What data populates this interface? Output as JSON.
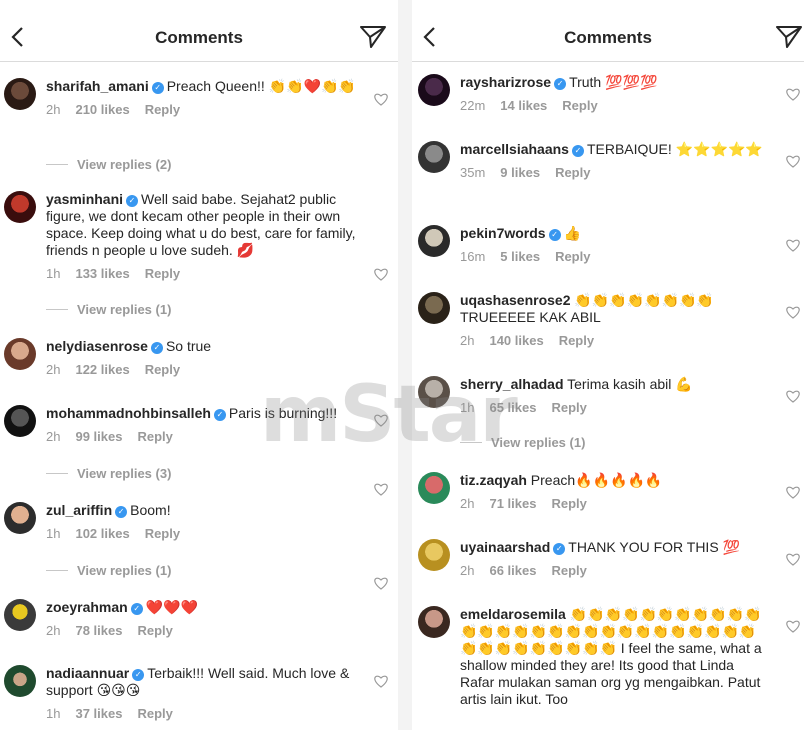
{
  "left": {
    "header": {
      "title": "Comments"
    },
    "comments": [
      {
        "username": "sharifah_amani",
        "text": "Preach Queen!! 👏👏❤️👏👏",
        "time": "2h",
        "likes": "210 likes",
        "reply": "Reply",
        "view_replies": "View replies (2)"
      },
      {
        "username": "yasminhani",
        "text": "Well said babe. Sejahat2 public figure, we dont kecam other people in their own space. Keep doing what u do best, care for family, friends n people u love sudeh. 💋",
        "time": "1h",
        "likes": "133 likes",
        "reply": "Reply",
        "view_replies": "View replies (1)"
      },
      {
        "username": "nelydiasenrose",
        "text": "So true",
        "time": "2h",
        "likes": "122 likes",
        "reply": "Reply"
      },
      {
        "username": "mohammadnohbinsalleh",
        "text": "Paris is burning!!!",
        "time": "2h",
        "likes": "99 likes",
        "reply": "Reply",
        "view_replies": "View replies (3)"
      },
      {
        "username": "zul_ariffin",
        "text": "Boom!",
        "time": "1h",
        "likes": "102 likes",
        "reply": "Reply",
        "view_replies": "View replies (1)"
      },
      {
        "username": "zoeyrahman",
        "text": "❤️❤️❤️",
        "time": "2h",
        "likes": "78 likes",
        "reply": "Reply"
      },
      {
        "username": "nadiaannuar",
        "text": "Terbaik!!! Well said. Much love & support 😘😘😘",
        "time": "1h",
        "likes": "37 likes",
        "reply": "Reply"
      }
    ]
  },
  "right": {
    "header": {
      "title": "Comments"
    },
    "comments": [
      {
        "username": "raysharizrose",
        "text": "Truth 💯💯💯",
        "time": "22m",
        "likes": "14 likes",
        "reply": "Reply"
      },
      {
        "username": "marcellsiahaans",
        "text": "TERBAIQUE! ⭐⭐⭐⭐⭐",
        "time": "35m",
        "likes": "9 likes",
        "reply": "Reply"
      },
      {
        "username": "pekin7words",
        "text": "👍",
        "time": "16m",
        "likes": "5 likes",
        "reply": "Reply"
      },
      {
        "username": "uqashasenrose2",
        "text": "👏👏👏👏👏👏👏👏 TRUEEEEE KAK ABIL",
        "time": "2h",
        "likes": "140 likes",
        "reply": "Reply"
      },
      {
        "username": "sherry_alhadad",
        "text": "Terima kasih abil 💪",
        "time": "1h",
        "likes": "65 likes",
        "reply": "Reply",
        "view_replies": "View replies (1)"
      },
      {
        "username": "tiz.zaqyah",
        "text": "Preach🔥🔥🔥🔥🔥",
        "time": "2h",
        "likes": "71 likes",
        "reply": "Reply"
      },
      {
        "username": "uyainaarshad",
        "text": "THANK YOU FOR THIS 💯",
        "time": "2h",
        "likes": "66 likes",
        "reply": "Reply"
      },
      {
        "username": "emeldarosemila",
        "text": "👏👏👏👏👏👏👏👏👏👏👏👏👏👏👏👏👏👏👏👏👏👏👏👏👏👏👏👏👏👏👏👏👏👏👏👏👏 I feel the same, what a shallow minded they are! Its good that Linda Rafar mulakan saman org yg mengaibkan. Patut artis lain ikut. Too"
      }
    ]
  },
  "watermark": "mStar",
  "colors": {
    "verified": "#3897f0",
    "meta": "#999999",
    "text": "#262626"
  }
}
